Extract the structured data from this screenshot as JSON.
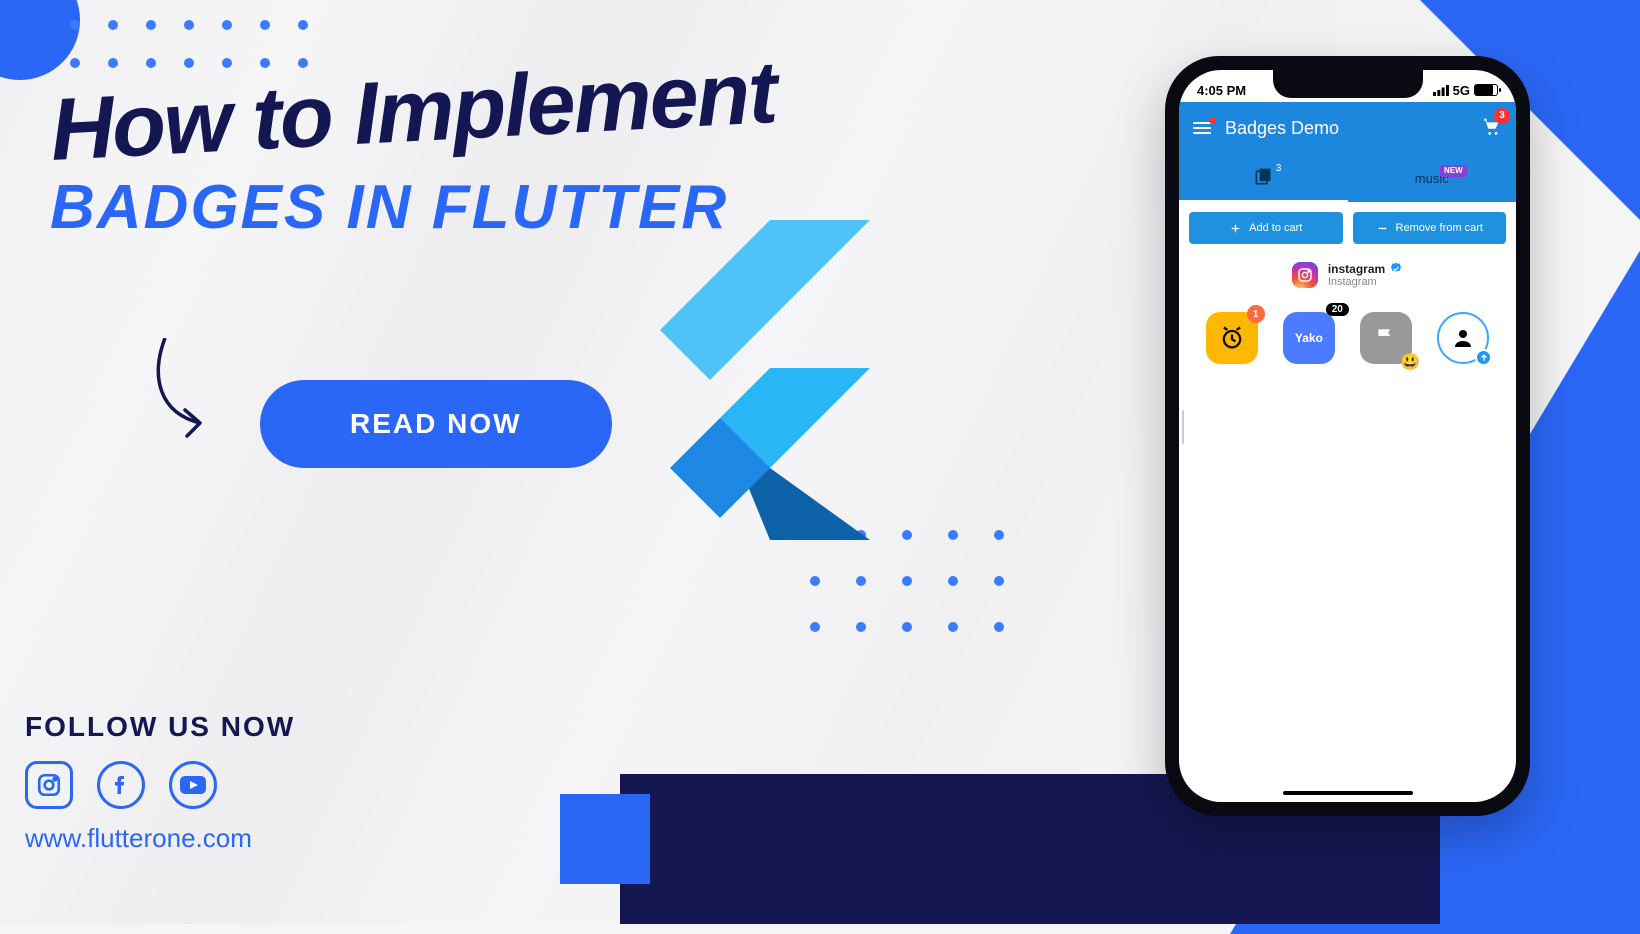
{
  "headline": {
    "line1": "How to Implement",
    "line2": "BADGES IN FLUTTER"
  },
  "cta": {
    "read_label": "READ NOW"
  },
  "follow": {
    "heading": "FOLLOW US NOW",
    "url": "www.flutterone.com"
  },
  "phone": {
    "status": {
      "time": "4:05 PM",
      "network": "5G"
    },
    "appbar": {
      "title": "Badges Demo",
      "cart_count": "3"
    },
    "tabs": {
      "tab1_badge": "3",
      "tab2_label": "music",
      "tab2_new": "NEW"
    },
    "buttons": {
      "add": "Add to cart",
      "remove": "Remove from cart"
    },
    "instagram": {
      "name": "instagram",
      "sub": "Instagram"
    },
    "tiles": {
      "alarm_badge": "1",
      "yako_label": "Yako",
      "yako_badge": "20"
    }
  }
}
